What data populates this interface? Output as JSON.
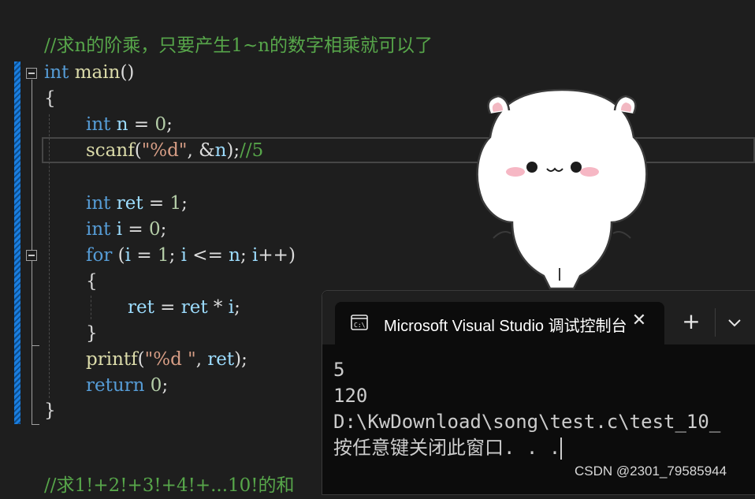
{
  "editor": {
    "comment_top": "//求n的阶乘，只要产生1~n的数字相乘就可以了",
    "l_main": {
      "kw": "int",
      "fn": "main",
      "p": "()"
    },
    "l_brace_open": "{",
    "l_int_n": {
      "kw": "int",
      "var": "n",
      "op": " = ",
      "num": "0",
      "end": ";"
    },
    "l_scanf": {
      "fn": "scanf",
      "p1": "(",
      "str": "\"%d\"",
      "p2": ", &",
      "var": "n",
      "p3": ");",
      "cm": "//5"
    },
    "l_int_ret": {
      "kw": "int",
      "var": "ret",
      "op": " = ",
      "num": "1",
      "end": ";"
    },
    "l_int_i": {
      "kw": "int",
      "var": "i",
      "op": " = ",
      "num": "0",
      "end": ";"
    },
    "l_for": {
      "kw": "for",
      "p1": " (",
      "v1": "i",
      "op1": " = ",
      "num": "1",
      "p2": "; ",
      "v2": "i",
      "op2": " <= ",
      "v3": "n",
      "p3": "; ",
      "v4": "i",
      "p4": "++)"
    },
    "l_for_open": "{",
    "l_ret_mul": {
      "v1": "ret",
      "op1": " = ",
      "v2": "ret",
      "op2": " * ",
      "v3": "i",
      "end": ";"
    },
    "l_for_close": "}",
    "l_printf": {
      "fn": "printf",
      "p1": "(",
      "str": "\"%d \"",
      "p2": ", ",
      "var": "ret",
      "p3": ");"
    },
    "l_return": {
      "kw": "return",
      "num": "0",
      "end": ";"
    },
    "l_brace_close": "}",
    "comment_bottom": "//求1!+2!+3!+4!+...10!的和"
  },
  "terminal": {
    "tab_title": "Microsoft Visual Studio 调试控制台",
    "close_label": "✕",
    "new_tab_label": "+",
    "output": [
      "5",
      "120",
      "D:\\KwDownload\\song\\test.c\\test_10_",
      "按任意键关闭此窗口. . ."
    ]
  },
  "watermark": "CSDN @2301_79585944",
  "icons": [
    "collapse-icon",
    "console-app-icon",
    "close-icon",
    "add-tab-icon",
    "chevron-down-icon",
    "sticker-bear"
  ]
}
